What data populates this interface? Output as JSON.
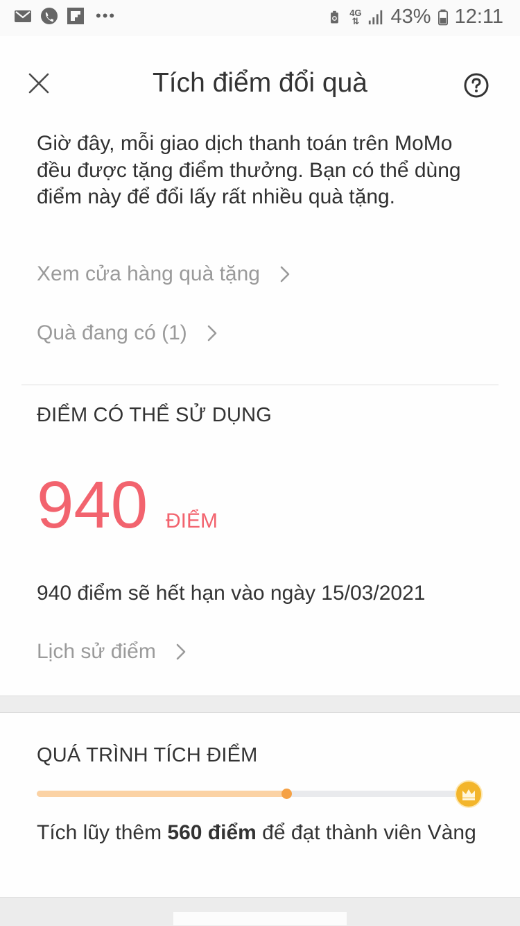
{
  "status_bar": {
    "battery_percent": "43%",
    "time": "12:11",
    "network": "4G",
    "left_icons": [
      "gmail-icon",
      "phone-icon",
      "flipboard-icon",
      "more-dots-icon"
    ],
    "right_icons": [
      "battery-saver-icon",
      "network-4g-icon",
      "signal-icon",
      "battery-icon"
    ]
  },
  "header": {
    "title": "Tích điểm đổi quà",
    "close_icon": "close-icon",
    "help_icon": "help-circle-icon"
  },
  "intro": {
    "text": "Giờ đây, mỗi giao dịch thanh toán trên MoMo đều được tặng điểm thưởng. Bạn có thể dùng điểm này để đổi lấy rất nhiều quà tặng."
  },
  "links": {
    "gift_store": "Xem cửa hàng quà tặng",
    "my_gifts": "Quà đang có (1)",
    "history": "Lịch sử điểm"
  },
  "points": {
    "section_title": "ĐIỂM CÓ THỂ SỬ DỤNG",
    "value": "940",
    "unit": "ĐIỂM",
    "expiry_text": "940 điểm sẽ hết hạn vào ngày 15/03/2021"
  },
  "progress": {
    "section_title": "QUÁ TRÌNH TÍCH ĐIỂM",
    "fraction": 0.59,
    "goal_icon": "crown-icon",
    "message_prefix": "Tích lũy thêm ",
    "message_bold": "560 điểm",
    "message_suffix": " để đạt thành viên Vàng"
  },
  "colors": {
    "accent_red": "#f2636e",
    "progress_fill": "#fbd2a4",
    "progress_knob": "#f5a145",
    "gold": "#f3b52b"
  }
}
